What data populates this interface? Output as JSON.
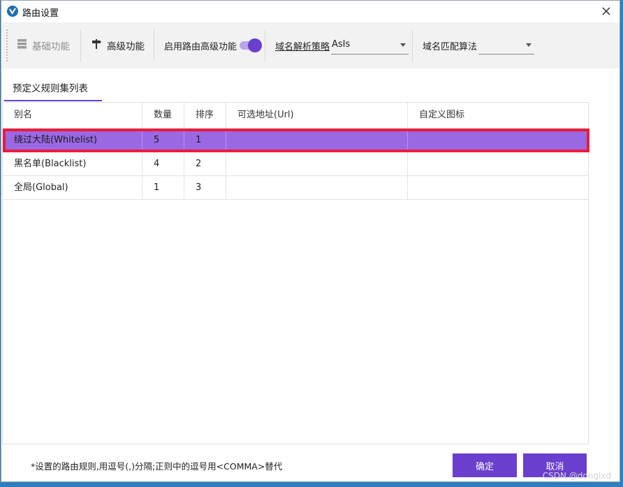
{
  "window": {
    "title": "路由设置"
  },
  "toolbar": {
    "basic_label": "基础功能",
    "advanced_label": "高级功能",
    "enable_advanced_label": "启用路由高级功能",
    "enable_advanced_on": true,
    "dns_strategy_label": "域名解析策略",
    "dns_strategy_value": "AsIs",
    "domain_match_label": "域名匹配算法",
    "domain_match_value": ""
  },
  "tabs": [
    {
      "label": "预定义规则集列表",
      "active": true
    }
  ],
  "table": {
    "columns": [
      "别名",
      "数量",
      "排序",
      "可选地址(Url)",
      "自定义图标"
    ],
    "rows": [
      {
        "alias": "绕过大陆(Whitelist)",
        "count": "5",
        "order": "1",
        "url": "",
        "icon": "",
        "selected": true
      },
      {
        "alias": "黑名单(Blacklist)",
        "count": "4",
        "order": "2",
        "url": "",
        "icon": "",
        "selected": false
      },
      {
        "alias": "全局(Global)",
        "count": "1",
        "order": "3",
        "url": "",
        "icon": "",
        "selected": false
      }
    ]
  },
  "footer": {
    "note": "*设置的路由规则,用逗号(,)分隔;正则中的逗号用<COMMA>替代",
    "ok_label": "确定",
    "cancel_label": "取消"
  },
  "watermark": "CSDN @donglxd",
  "colors": {
    "accent": "#6a3fce",
    "selected_row": "#9b68e4",
    "highlight_outline": "#ea1c3c"
  }
}
